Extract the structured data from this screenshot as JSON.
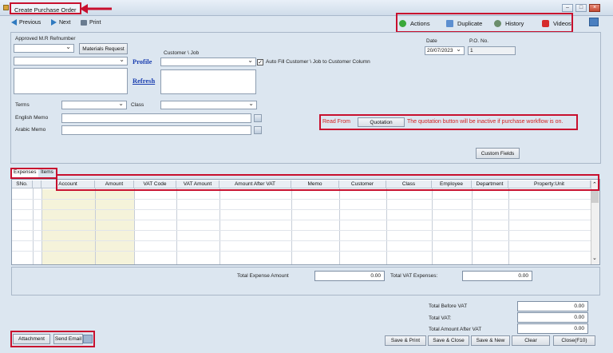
{
  "window": {
    "title": "Create Purchase Order"
  },
  "toolbar": {
    "previous": "Previous",
    "next": "Next",
    "print": "Print"
  },
  "actions": {
    "actions": "Actions",
    "duplicate": "Duplicate",
    "history": "History",
    "videos": "Videos"
  },
  "form": {
    "approved_label": "Approved M.R Refnumber",
    "materials_request": "Materials Request",
    "profile_link": "Profile",
    "refresh_link": "Refresh",
    "customer_job_label": "Customer \\ Job",
    "autofill_label": "Auto Fill Customer \\ Job to Customer Column",
    "autofill_checked": "✓",
    "date_label": "Date",
    "date_value": "20/07/2023",
    "po_label": "P.O. No.",
    "po_value": "1",
    "terms_label": "Terms",
    "class_label": "Class",
    "english_memo_label": "English Memo",
    "arabic_memo_label": "Arabic Memo",
    "read_from_label": "Read From",
    "quotation_button": "Quotation",
    "quotation_note": "The quotation button will be inactive if purchase workflow is on.",
    "custom_fields_button": "Custom Fields"
  },
  "tabs": {
    "expenses": "Expenses",
    "items": "Items"
  },
  "grid": {
    "columns": [
      "SNo.",
      "",
      "Account",
      "Amount",
      "VAT Code",
      "VAT Amount",
      "Amount After VAT",
      "Memo",
      "Customer",
      "Class",
      "Employee",
      "Department",
      "Property:Unit"
    ]
  },
  "totals": {
    "total_expense_label": "Total Expense Amount",
    "total_expense_value": "0.00",
    "total_vat_expenses_label": "Total VAT Expenses:",
    "total_vat_expenses_value": "0.00",
    "total_before_vat_label": "Total Before VAT",
    "total_before_vat_value": "0.00",
    "total_vat_label": "Total VAT:",
    "total_vat_value": "0.00",
    "total_after_vat_label": "Total Amount After VAT",
    "total_after_vat_value": "0.00"
  },
  "footer": {
    "attachment": "Attachment",
    "send_email": "Send Email",
    "save_print": "Save & Print",
    "save_close": "Save & Close",
    "save_new": "Save & New",
    "clear": "Clear",
    "close": "Close(F10)"
  },
  "colors": {
    "highlight": "#c8102e",
    "link": "#1b3fb0",
    "note": "#d42020",
    "accent_yellow": "#f5f3da"
  }
}
